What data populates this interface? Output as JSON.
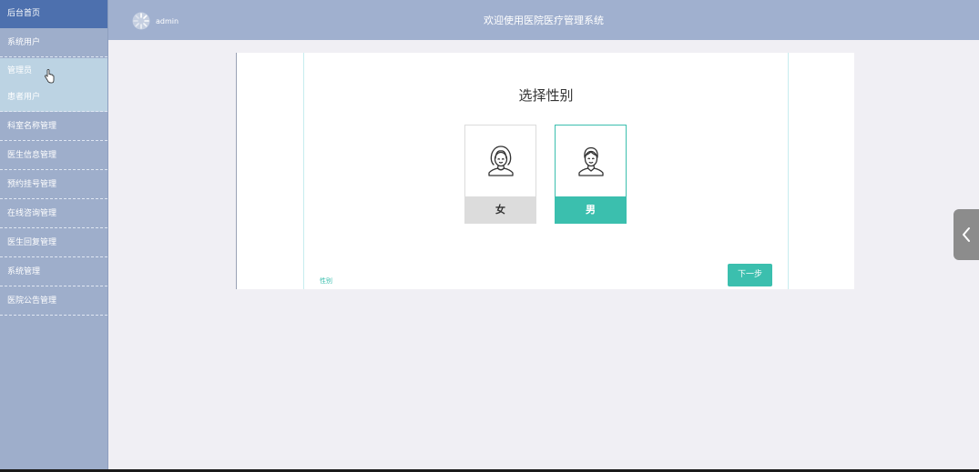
{
  "sidebar": {
    "home": "后台首页",
    "items": [
      {
        "label": "系统用户"
      },
      {
        "label": "科室名称管理"
      },
      {
        "label": "医生信息管理"
      },
      {
        "label": "预约挂号管理"
      },
      {
        "label": "在线咨询管理"
      },
      {
        "label": "医生回复管理"
      },
      {
        "label": "系统管理"
      },
      {
        "label": "医院公告管理"
      }
    ],
    "submenu": [
      {
        "label": "管理员"
      },
      {
        "label": "患者用户"
      }
    ]
  },
  "header": {
    "user": "admin",
    "title": "欢迎使用医院医疗管理系统"
  },
  "form": {
    "question": "选择性别",
    "options": {
      "female": "女",
      "male": "男"
    },
    "selected": "male",
    "field_label": "性别",
    "next_label": "下一步"
  },
  "colors": {
    "accent": "#3bbfae",
    "sidebar": "#9eaecb",
    "sidebar_active": "#4d70ae",
    "header": "#a0b0cf"
  },
  "icons": {
    "avatar": "loading-spinner-icon",
    "female": "female-user-icon",
    "male": "male-user-icon",
    "collapse": "chevron-left-icon"
  }
}
